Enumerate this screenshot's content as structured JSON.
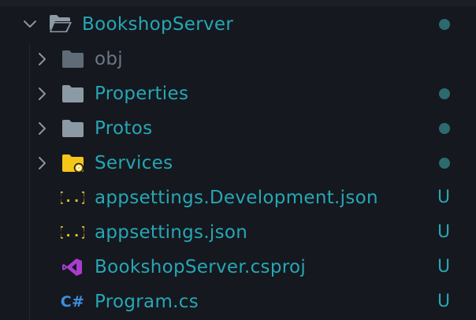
{
  "explorer": {
    "root": {
      "label": "BookshopServer",
      "icon": "folder-open-icon",
      "expanded": true,
      "status": "dot"
    },
    "items": [
      {
        "label": "obj",
        "icon": "folder-icon",
        "status": "none",
        "ignored": true
      },
      {
        "label": "Properties",
        "icon": "folder-icon",
        "status": "dot"
      },
      {
        "label": "Protos",
        "icon": "folder-icon",
        "status": "dot"
      },
      {
        "label": "Services",
        "icon": "folder-services-icon",
        "status": "dot"
      },
      {
        "label": "appsettings.Development.json",
        "icon": "json-icon",
        "status": "U",
        "icon_text": "{..}"
      },
      {
        "label": "appsettings.json",
        "icon": "json-icon",
        "status": "U",
        "icon_text": "{..}"
      },
      {
        "label": "BookshopServer.csproj",
        "icon": "visual-studio-icon",
        "status": "U"
      },
      {
        "label": "Program.cs",
        "icon": "csharp-icon",
        "status": "U",
        "icon_text": "C#"
      }
    ]
  },
  "colors": {
    "background": "#15181e",
    "text": "#26a7b5",
    "ignored_text": "#6b7884",
    "folder": "#8c9aa6",
    "services_folder": "#f5c518",
    "json_icon": "#f2c230",
    "vs_icon": "#a93ccf",
    "csharp_icon": "#3d8fe0",
    "modified_dot": "#2b6b6f"
  }
}
